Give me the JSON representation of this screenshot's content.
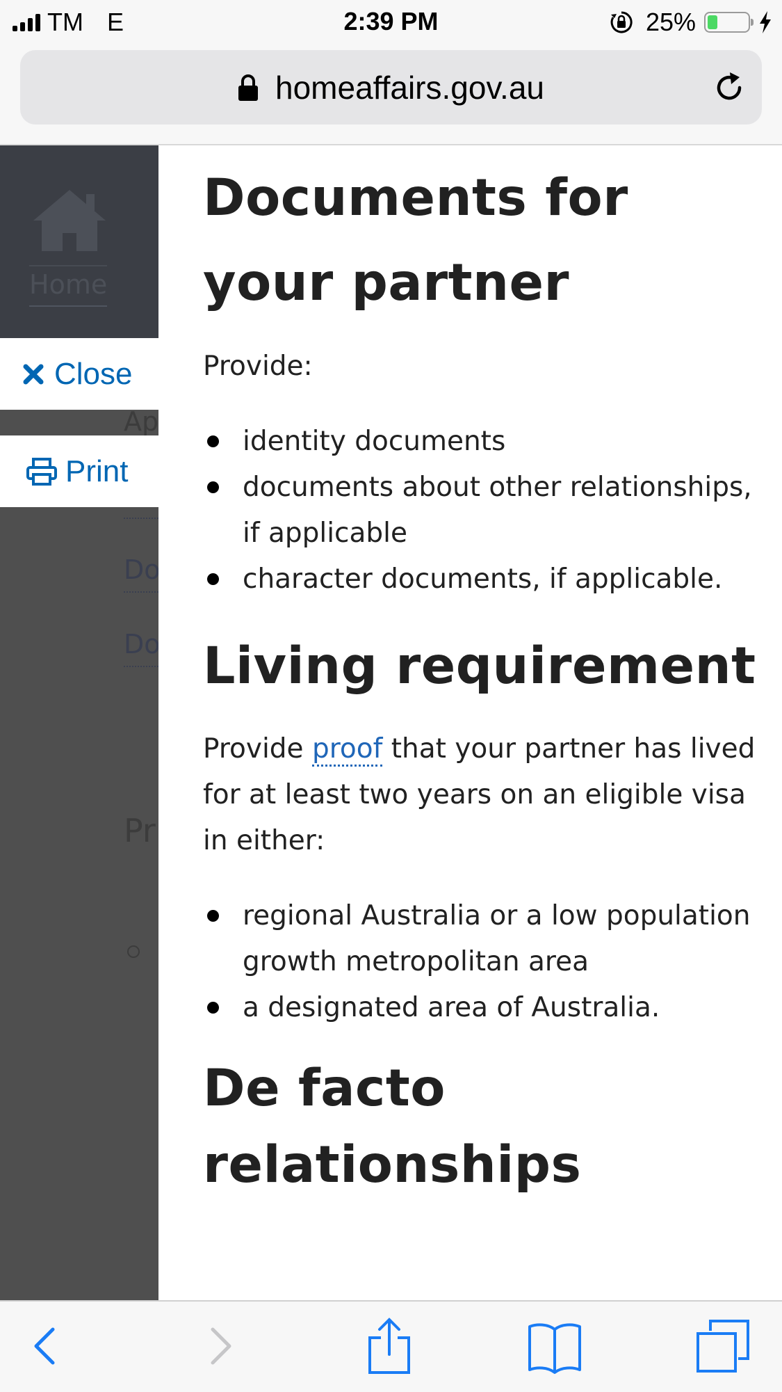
{
  "status_bar": {
    "carrier": "TM",
    "network": "E",
    "time": "2:39 PM",
    "battery_percent": "25%",
    "battery_level": 0.25
  },
  "browser": {
    "url": "homeaffairs.gov.au"
  },
  "sidebar": {
    "home_label": "Home",
    "close_label": "Close",
    "print_label": "Print",
    "ghost_ap": "Ap",
    "ghost_do1": "Do",
    "ghost_do2": "Do",
    "ghost_pr": "Pr"
  },
  "content": {
    "heading1_line1": "Documents for",
    "heading1_line2": "your partner",
    "provide_label": "Provide:",
    "documents_list": [
      "identity documents",
      "documents about other relationships, if applicable",
      "character documents, if applicable."
    ],
    "heading2": "Living requirement",
    "living_text_before": "Provide ",
    "living_link": "proof",
    "living_text_after": " that your partner has lived for at least two years on an eligible visa in either:",
    "areas_list": [
      "regional Australia or a low population growth metropolitan area",
      "a designated area of Australia."
    ],
    "heading3_line1": "De facto",
    "heading3_line2": "relationships"
  },
  "icons": {
    "padlock": "padlock-icon",
    "reload": "reload-icon",
    "home": "home-icon",
    "close": "close-icon",
    "print": "printer-icon",
    "back": "back-chevron-icon",
    "forward": "forward-chevron-icon",
    "share": "share-icon",
    "bookmarks": "bookmarks-icon",
    "tabs": "tabs-icon"
  },
  "colors": {
    "link": "#1f66b8",
    "sidebar_button_text": "#0066b3",
    "toolbar_icon": "#1a7cf5",
    "sidebar_overlay": "#4f4f4f"
  }
}
